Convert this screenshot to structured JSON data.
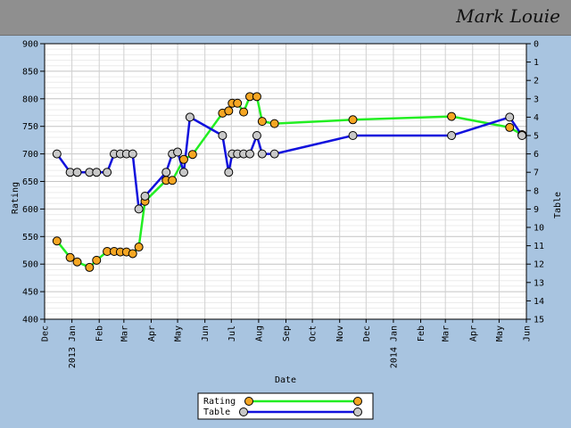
{
  "header": {
    "title": "Mark Louie"
  },
  "chart_data": {
    "type": "line",
    "xlabel": "Date",
    "ylabel_left": "Rating",
    "ylabel_right": "Table",
    "ylim_left": [
      400,
      900
    ],
    "ylim_right": [
      15,
      0
    ],
    "yticks_left": [
      400,
      450,
      500,
      550,
      600,
      650,
      700,
      750,
      800,
      850,
      900
    ],
    "yticks_right": [
      0,
      1,
      2,
      3,
      4,
      5,
      6,
      7,
      8,
      9,
      10,
      11,
      12,
      13,
      14,
      15
    ],
    "x_tick_labels": [
      "Dec",
      "2013 Jan",
      "Feb",
      "Mar",
      "Apr",
      "May",
      "Jun",
      "Jul",
      "Aug",
      "Sep",
      "Oct",
      "Nov",
      "Dec",
      "2014 Jan",
      "Feb",
      "Mar",
      "Apr",
      "May",
      "Jun"
    ],
    "grid": true,
    "legend_position": "bottom-center",
    "series": [
      {
        "name": "Rating",
        "axis": "left",
        "color": "#22ee22",
        "marker_color": "#f5a623",
        "points": [
          [
            "2012-12-15",
            542
          ],
          [
            "2012-12-30",
            512
          ],
          [
            "2013-01-07",
            504
          ],
          [
            "2013-01-21",
            494
          ],
          [
            "2013-01-29",
            507
          ],
          [
            "2013-02-10",
            523
          ],
          [
            "2013-02-18",
            523
          ],
          [
            "2013-02-25",
            522
          ],
          [
            "2013-03-04",
            522
          ],
          [
            "2013-03-11",
            519
          ],
          [
            "2013-03-18",
            531
          ],
          [
            "2013-03-25",
            614
          ],
          [
            "2013-04-18",
            652
          ],
          [
            "2013-04-25",
            652
          ],
          [
            "2013-05-08",
            690
          ],
          [
            "2013-05-18",
            699
          ],
          [
            "2013-06-21",
            774
          ],
          [
            "2013-06-28",
            778
          ],
          [
            "2013-07-02",
            792
          ],
          [
            "2013-07-08",
            792
          ],
          [
            "2013-07-15",
            776
          ],
          [
            "2013-07-22",
            804
          ],
          [
            "2013-07-30",
            804
          ],
          [
            "2013-08-05",
            759
          ],
          [
            "2013-08-19",
            755
          ],
          [
            "2013-11-16",
            762
          ],
          [
            "2014-03-08",
            768
          ],
          [
            "2014-05-13",
            748
          ],
          [
            "2014-05-27",
            735
          ]
        ]
      },
      {
        "name": "Table",
        "axis": "right",
        "color": "#1111dd",
        "marker_color": "#c8c8c8",
        "points": [
          [
            "2012-12-15",
            6
          ],
          [
            "2012-12-30",
            7
          ],
          [
            "2013-01-07",
            7
          ],
          [
            "2013-01-21",
            7
          ],
          [
            "2013-01-29",
            7
          ],
          [
            "2013-02-10",
            7
          ],
          [
            "2013-02-18",
            6
          ],
          [
            "2013-02-25",
            6
          ],
          [
            "2013-03-04",
            6
          ],
          [
            "2013-03-11",
            6
          ],
          [
            "2013-03-18",
            9
          ],
          [
            "2013-03-25",
            8.3
          ],
          [
            "2013-04-18",
            7
          ],
          [
            "2013-04-25",
            6
          ],
          [
            "2013-05-01",
            5.9
          ],
          [
            "2013-05-08",
            7
          ],
          [
            "2013-05-15",
            4
          ],
          [
            "2013-06-21",
            5
          ],
          [
            "2013-06-28",
            7
          ],
          [
            "2013-07-02",
            6
          ],
          [
            "2013-07-08",
            6
          ],
          [
            "2013-07-15",
            6
          ],
          [
            "2013-07-22",
            6
          ],
          [
            "2013-07-30",
            5
          ],
          [
            "2013-08-05",
            6
          ],
          [
            "2013-08-19",
            6
          ],
          [
            "2013-11-16",
            5
          ],
          [
            "2014-03-08",
            5
          ],
          [
            "2014-05-13",
            4
          ],
          [
            "2014-05-27",
            5
          ]
        ]
      }
    ]
  }
}
